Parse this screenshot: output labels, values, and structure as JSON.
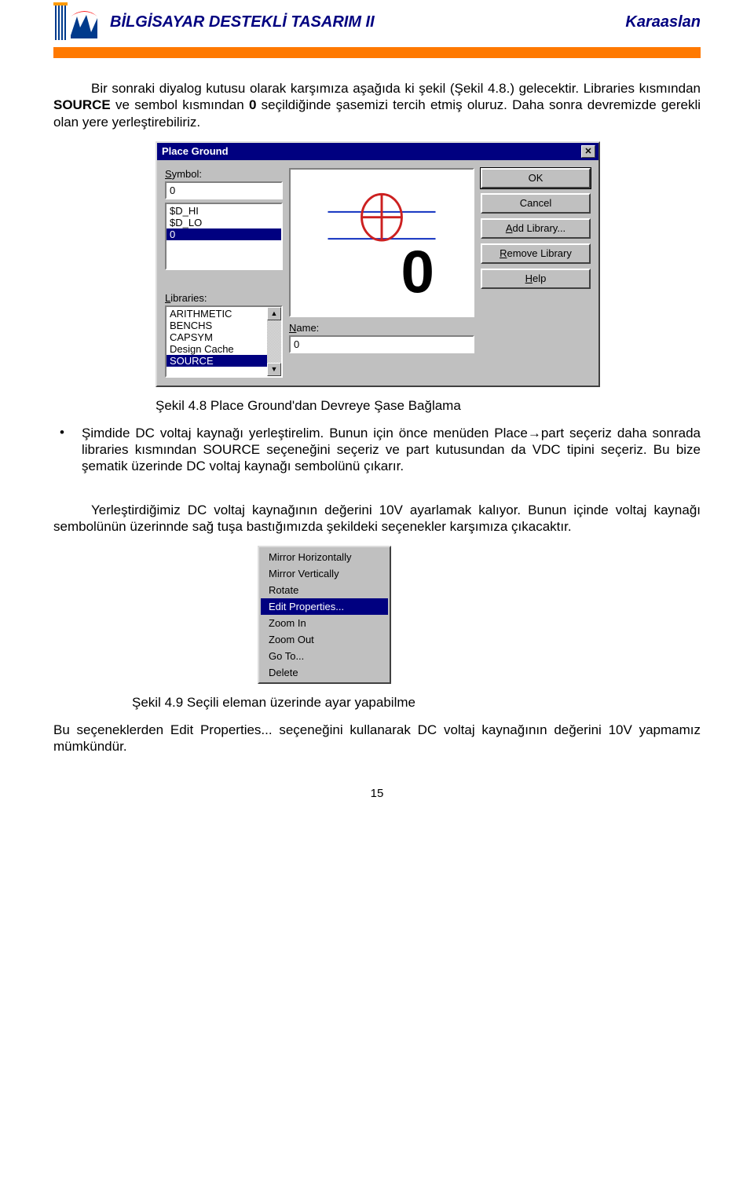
{
  "header": {
    "course_title": "BİLGİSAYAR DESTEKLİ TASARIM II",
    "author": "Karaaslan"
  },
  "para1_a": "Bir sonraki diyalog kutusu olarak karşımıza aşağıda ki şekil (Şekil 4.8.) gelecektir. Libraries kısmından ",
  "para1_b": "SOURCE",
  "para1_c": " ve sembol kısmından ",
  "para1_d": "0",
  "para1_e": " seçildiğinde şasemizi tercih etmiş oluruz. Daha sonra devremizde gerekli olan yere yerleştirebiliriz.",
  "dialog": {
    "title": "Place Ground",
    "symbol_label": "Symbol:",
    "symbol_value": "0",
    "symbol_list": [
      "$D_HI",
      "$D_LO",
      "0"
    ],
    "symbol_selected": "0",
    "libraries_label": "Libraries:",
    "libraries_list": [
      "ARITHMETIC",
      "BENCHS",
      "CAPSYM",
      "Design Cache",
      "SOURCE"
    ],
    "libraries_selected": "SOURCE",
    "name_label": "Name:",
    "name_value": "0",
    "buttons": {
      "ok": "OK",
      "cancel": "Cancel",
      "add": "Add Library...",
      "remove": "Remove Library",
      "help": "Help"
    }
  },
  "caption1": "Şekil 4.8  Place Ground'dan Devreye Şase Bağlama",
  "bullet1": "Şimdide DC voltaj kaynağı yerleştirelim. Bunun için önce menüden Place→part seçeriz daha sonrada libraries kısmından SOURCE seçeneğini seçeriz ve part kutusundan da VDC tipini seçeriz. Bu bize şematik üzerinde DC voltaj kaynağı sembolünü çıkarır.",
  "para2": "Yerleştirdiğimiz DC voltaj kaynağının değerini 10V ayarlamak kalıyor. Bunun içinde voltaj kaynağı sembolünün üzerinnde  sağ tuşa bastığımızda şekildeki seçenekler karşımıza çıkacaktır.",
  "context_menu": {
    "items": [
      "Mirror Horizontally",
      "Mirror Vertically",
      "Rotate",
      "Edit Properties...",
      "Zoom In",
      "Zoom Out",
      "Go To...",
      "Delete"
    ],
    "selected": "Edit Properties..."
  },
  "caption2": "Şekil 4.9 Seçili eleman üzerinde ayar yapabilme",
  "para3": "Bu seçeneklerden Edit Properties... seçeneğini kullanarak DC voltaj kaynağının değerini 10V yapmamız mümkündür.",
  "page_number": "15"
}
